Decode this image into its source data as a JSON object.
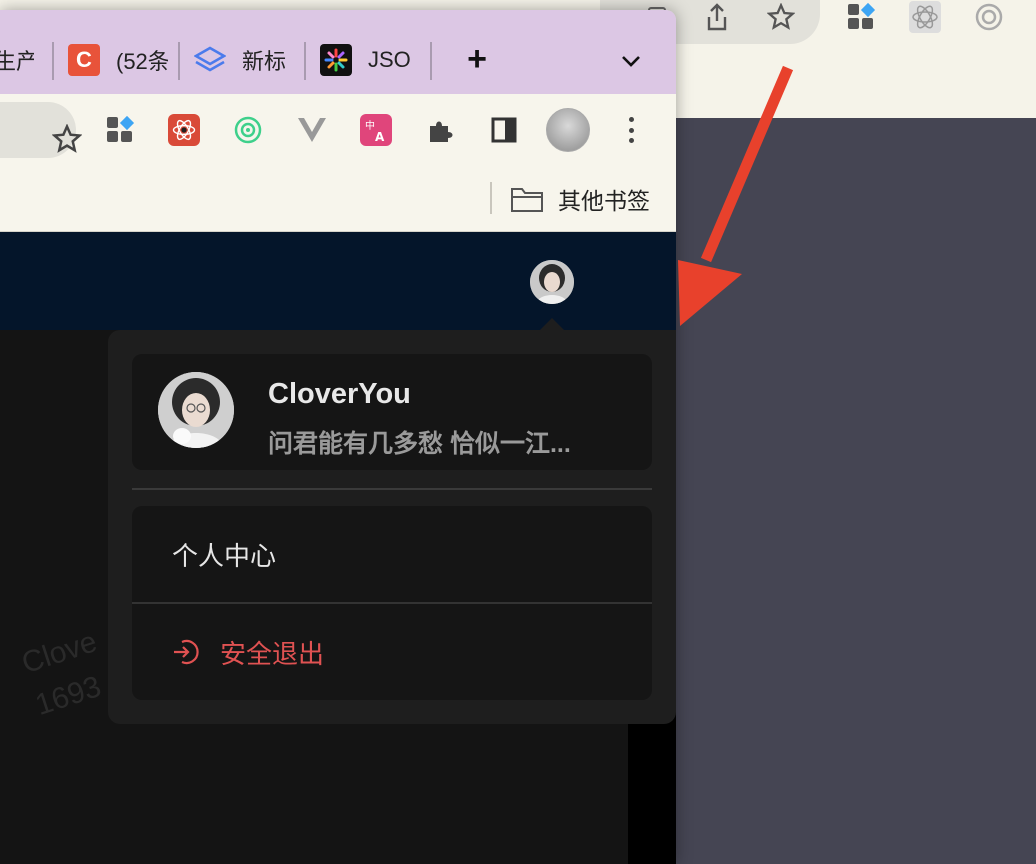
{
  "tabs": [
    {
      "label": "生产",
      "favicon": "none"
    },
    {
      "label": "(52条",
      "favicon": "c-logo",
      "color": "#e8533a"
    },
    {
      "label": "新标",
      "favicon": "layers-logo",
      "color": "#4b7bec"
    },
    {
      "label": "JSO",
      "favicon": "json-logo",
      "color": "#111111"
    }
  ],
  "bookmarks": {
    "other_label": "其他书签"
  },
  "popover": {
    "username": "CloverYou",
    "bio": "问君能有几多愁 恰似一江...",
    "profile_label": "个人中心",
    "logout_label": "安全退出"
  },
  "background_text": {
    "line1": "Clove",
    "line2": "1693"
  },
  "colors": {
    "tabstrip": "#dcc7e4",
    "toolbar": "#f7f5ec",
    "site_header": "#04152a",
    "popover_bg": "#1e1e1e",
    "logout_red": "#e05252",
    "annotation_arrow": "#e8412c"
  }
}
